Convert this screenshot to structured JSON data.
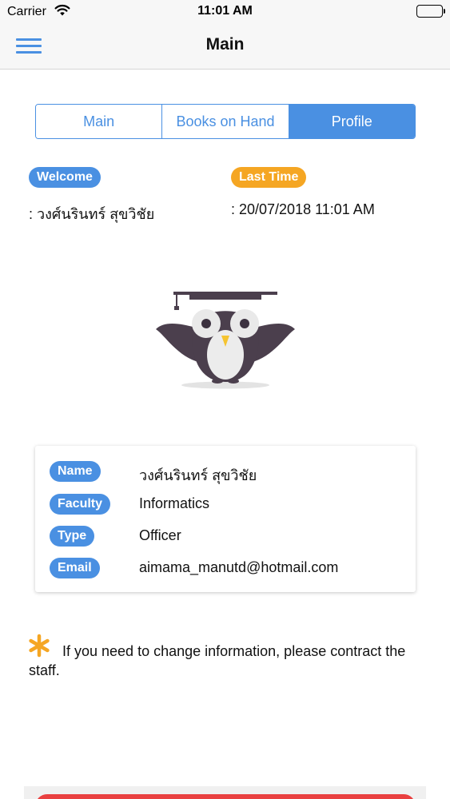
{
  "status_bar": {
    "carrier": "Carrier",
    "time": "11:01 AM",
    "wifi_icon": "wifi-icon",
    "battery_icon": "battery-icon"
  },
  "nav": {
    "title": "Main",
    "menu_icon": "hamburger-menu-icon"
  },
  "tabs": [
    {
      "label": "Main",
      "active": false
    },
    {
      "label": "Books on Hand",
      "active": false
    },
    {
      "label": "Profile",
      "active": true
    }
  ],
  "welcome": {
    "badge": "Welcome",
    "value": ": วงศ์นรินทร์ สุขวิชัย"
  },
  "last_time": {
    "badge": "Last Time",
    "value": ": 20/07/2018 11:01 AM"
  },
  "mascot_icon": "owl-graduate-icon",
  "profile": {
    "name_label": "Name",
    "name_value": "วงศ์นรินทร์ สุขวิชัย",
    "faculty_label": "Faculty",
    "faculty_value": "Informatics",
    "type_label": "Type",
    "type_value": "Officer",
    "email_label": "Email",
    "email_value": "aimama_manutd@hotmail.com"
  },
  "note": {
    "icon": "asterisk-icon",
    "text": "If you need to change information, please contract the staff."
  },
  "colors": {
    "accent": "#4a90e2",
    "orange": "#f5a623",
    "danger": "#e94040"
  }
}
